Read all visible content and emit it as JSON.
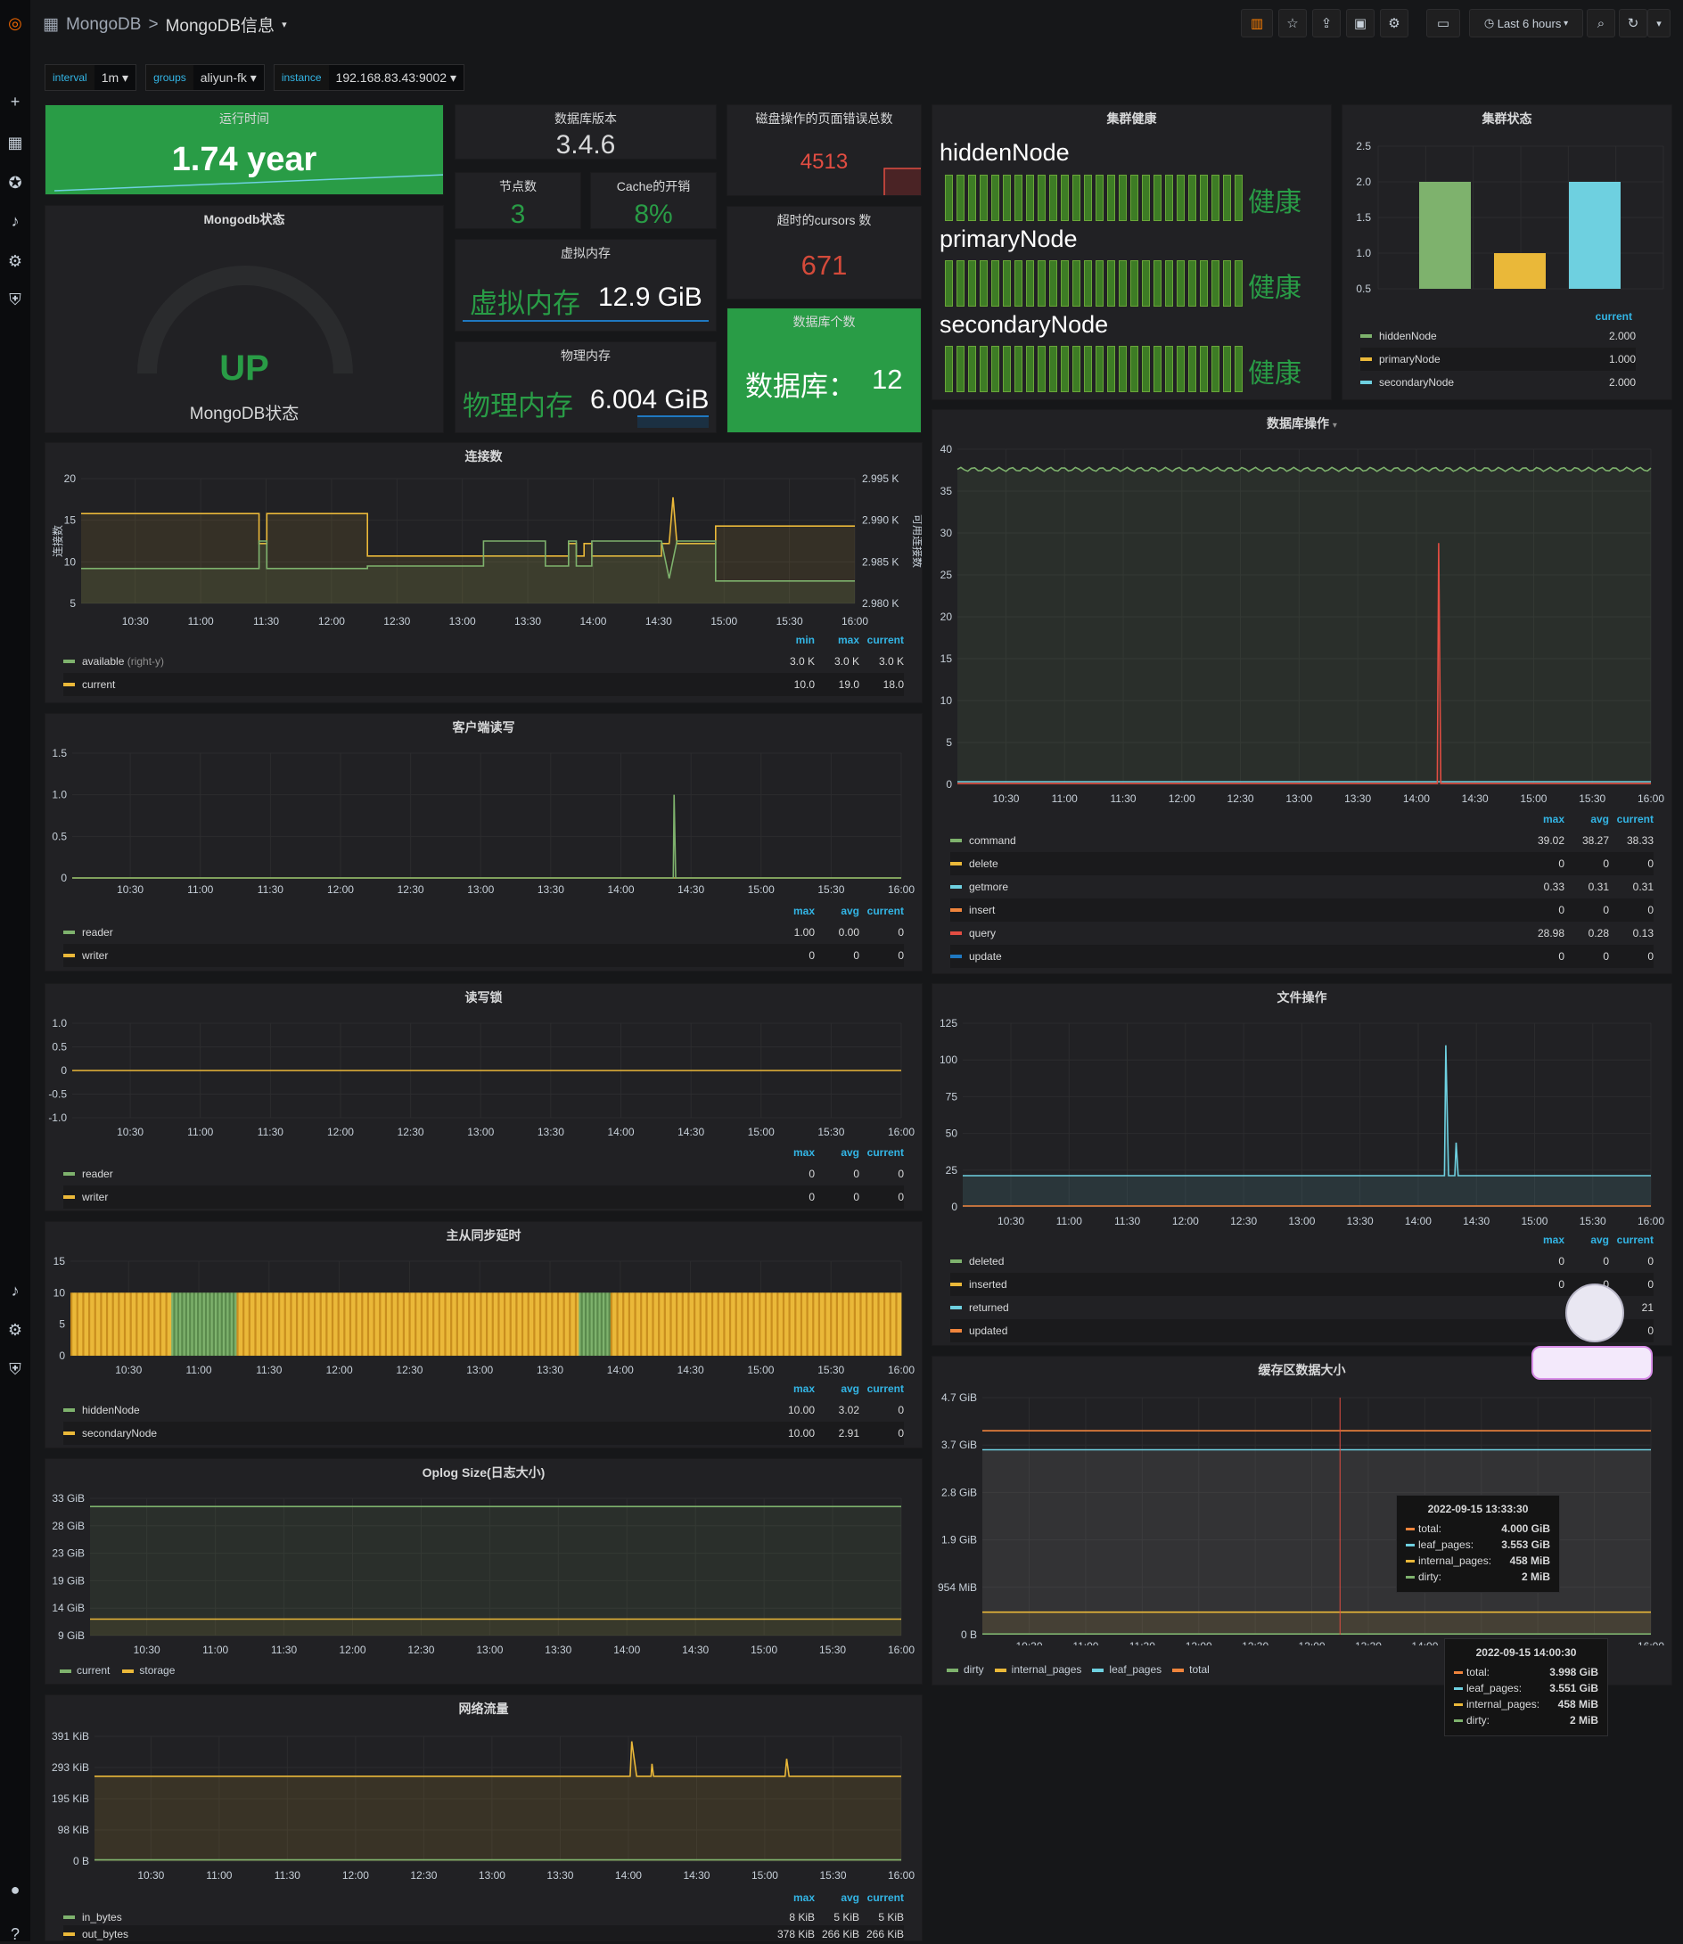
{
  "header": {
    "breadcrumb_parent": "MongoDB",
    "separator": ">",
    "title": "MongoDB信息",
    "time_range": "Last 6 hours"
  },
  "variables": [
    {
      "label": "interval",
      "value": "1m"
    },
    {
      "label": "groups",
      "value": "aliyun-fk"
    },
    {
      "label": "instance",
      "value": "192.168.83.43:9002"
    }
  ],
  "uptime": {
    "title": "运行时间",
    "value": "1.74 year"
  },
  "version": {
    "title": "数据库版本",
    "value": "3.4.6"
  },
  "nodes": {
    "title": "节点数",
    "value": "3"
  },
  "cache": {
    "title": "Cache的开销",
    "value": "8%"
  },
  "page_faults": {
    "title": "磁盘操作的页面错误总数",
    "value": "4513"
  },
  "cursors": {
    "title": "超时的cursors 数",
    "value": "671"
  },
  "status": {
    "title": "Mongodb状态",
    "value": "UP",
    "sub": "MongoDB状态"
  },
  "vmem": {
    "title": "虚拟内存",
    "label": "虚拟内存",
    "value": "12.9 GiB"
  },
  "pmem": {
    "title": "物理内存",
    "label": "物理内存",
    "value": "6.004 GiB"
  },
  "dbcount": {
    "title": "数据库个数",
    "label": "数据库：",
    "value": "12"
  },
  "health": {
    "title": "集群健康",
    "items": [
      {
        "name": "hiddenNode",
        "state": "健康"
      },
      {
        "name": "primaryNode",
        "state": "健康"
      },
      {
        "name": "secondaryNode",
        "state": "健康"
      }
    ]
  },
  "colors": {
    "green": "#7eb26d",
    "yellow": "#eab839",
    "cyan": "#6ed0e0",
    "orange": "#ef843c",
    "red": "#e24d42",
    "blue": "#1f78c1"
  },
  "time_ticks": [
    "10:30",
    "11:00",
    "11:30",
    "12:00",
    "12:30",
    "13:00",
    "13:30",
    "14:00",
    "14:30",
    "15:00",
    "15:30",
    "16:00"
  ],
  "legend_cols": {
    "min": "min",
    "max": "max",
    "avg": "avg",
    "current": "current"
  },
  "cluster_status": {
    "title": "集群状态",
    "chart_data": {
      "type": "bar",
      "categories": [
        "hiddenNode",
        "primaryNode",
        "secondaryNode"
      ],
      "values": [
        2,
        1,
        2
      ],
      "ylim": [
        0.5,
        2.5
      ],
      "yticks": [
        "2.5",
        "2.0",
        "1.5",
        "1.0",
        "0.5"
      ],
      "current": [
        "2.000",
        "1.000",
        "2.000"
      ]
    }
  },
  "connections": {
    "title": "连接数",
    "ylabel": "连接数",
    "ylabel_right": "可用连接数",
    "yticks": [
      "20",
      "15",
      "10",
      "5"
    ],
    "yticks_right": [
      "2.995 K",
      "2.990 K",
      "2.985 K",
      "2.980 K"
    ],
    "legend": [
      {
        "name": "available",
        "note": "(right-y)",
        "min": "3.0 K",
        "max": "3.0 K",
        "current": "3.0 K"
      },
      {
        "name": "current",
        "min": "10.0",
        "max": "19.0",
        "current": "18.0"
      }
    ]
  },
  "client_rw": {
    "title": "客户端读写",
    "yticks": [
      "1.5",
      "1.0",
      "0.5",
      "0"
    ],
    "legend": [
      {
        "name": "reader",
        "max": "1.00",
        "avg": "0.00",
        "current": "0"
      },
      {
        "name": "writer",
        "max": "0",
        "avg": "0",
        "current": "0"
      }
    ]
  },
  "rw_lock": {
    "title": "读写锁",
    "yticks": [
      "1.0",
      "0.5",
      "0",
      "-0.5",
      "-1.0"
    ],
    "legend": [
      {
        "name": "reader",
        "max": "0",
        "avg": "0",
        "current": "0"
      },
      {
        "name": "writer",
        "max": "0",
        "avg": "0",
        "current": "0"
      }
    ]
  },
  "repl_lag": {
    "title": "主从同步延时",
    "yticks": [
      "15",
      "10",
      "5",
      "0"
    ],
    "legend": [
      {
        "name": "hiddenNode",
        "max": "10.00",
        "avg": "3.02",
        "current": "0"
      },
      {
        "name": "secondaryNode",
        "max": "10.00",
        "avg": "2.91",
        "current": "0"
      }
    ]
  },
  "oplog": {
    "title": "Oplog Size(日志大小)",
    "yticks": [
      "33 GiB",
      "28 GiB",
      "23 GiB",
      "19 GiB",
      "14 GiB",
      "9 GiB"
    ],
    "legend": [
      "current",
      "storage"
    ]
  },
  "network": {
    "title": "网络流量",
    "yticks": [
      "391 KiB",
      "293 KiB",
      "195 KiB",
      "98 KiB",
      "0 B"
    ],
    "legend": [
      {
        "name": "in_bytes",
        "max": "8 KiB",
        "avg": "5 KiB",
        "current": "5 KiB"
      },
      {
        "name": "out_bytes",
        "max": "378 KiB",
        "avg": "266 KiB",
        "current": "266 KiB"
      }
    ]
  },
  "db_ops": {
    "title": "数据库操作",
    "yticks": [
      "40",
      "35",
      "30",
      "25",
      "20",
      "15",
      "10",
      "5",
      "0"
    ],
    "legend": [
      {
        "name": "command",
        "max": "39.02",
        "avg": "38.27",
        "current": "38.33"
      },
      {
        "name": "delete",
        "max": "0",
        "avg": "0",
        "current": "0"
      },
      {
        "name": "getmore",
        "max": "0.33",
        "avg": "0.31",
        "current": "0.31"
      },
      {
        "name": "insert",
        "max": "0",
        "avg": "0",
        "current": "0"
      },
      {
        "name": "query",
        "max": "28.98",
        "avg": "0.28",
        "current": "0.13"
      },
      {
        "name": "update",
        "max": "0",
        "avg": "0",
        "current": "0"
      }
    ]
  },
  "file_ops": {
    "title": "文件操作",
    "yticks": [
      "125",
      "100",
      "75",
      "50",
      "25",
      "0"
    ],
    "legend": [
      {
        "name": "deleted",
        "max": "0",
        "avg": "0",
        "current": "0"
      },
      {
        "name": "inserted",
        "max": "0",
        "avg": "0",
        "current": "0"
      },
      {
        "name": "returned",
        "max": "",
        "avg": "",
        "current": "21"
      },
      {
        "name": "updated",
        "max": "",
        "avg": "",
        "current": "0"
      }
    ]
  },
  "cache_size": {
    "title": "缓存区数据大小",
    "yticks": [
      "4.7 GiB",
      "3.7 GiB",
      "2.8 GiB",
      "1.9 GiB",
      "954 MiB",
      "0 B"
    ],
    "legend": [
      "dirty",
      "internal_pages",
      "leaf_pages",
      "total"
    ],
    "tooltip1": {
      "time": "2022-09-15 13:33:30",
      "rows": [
        {
          "name": "total:",
          "value": "4.000 GiB"
        },
        {
          "name": "leaf_pages:",
          "value": "3.553 GiB"
        },
        {
          "name": "internal_pages:",
          "value": "458 MiB"
        },
        {
          "name": "dirty:",
          "value": "2 MiB"
        }
      ]
    },
    "tooltip2": {
      "time": "2022-09-15 14:00:30",
      "rows": [
        {
          "name": "total:",
          "value": "3.998 GiB"
        },
        {
          "name": "leaf_pages:",
          "value": "3.551 GiB"
        },
        {
          "name": "internal_pages:",
          "value": "458 MiB"
        },
        {
          "name": "dirty:",
          "value": "2 MiB"
        }
      ]
    }
  }
}
